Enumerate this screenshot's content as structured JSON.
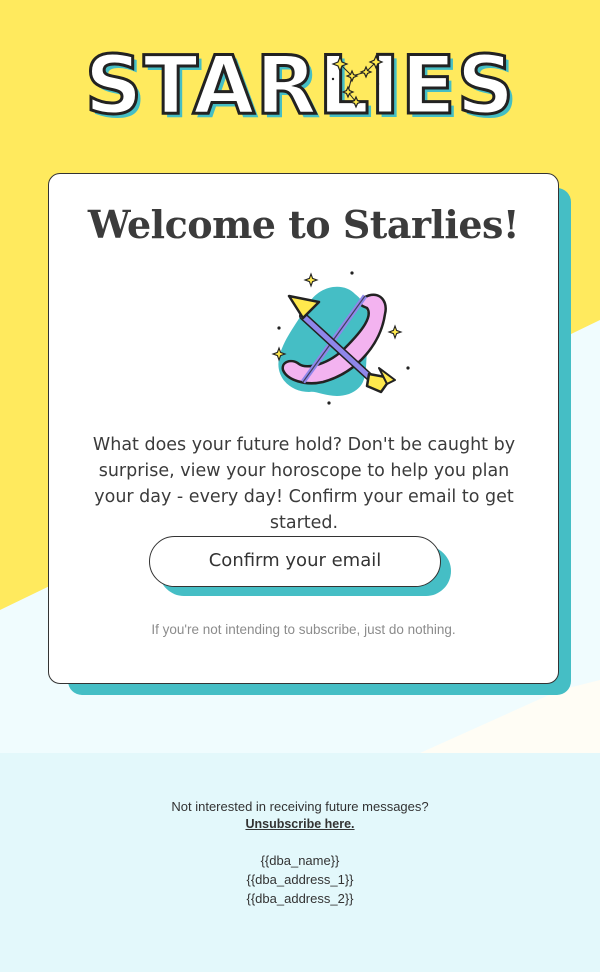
{
  "brand": {
    "logo_text": "STARLIES",
    "colors": {
      "yellow": "#ffea5e",
      "teal": "#45bec5",
      "pink": "#f3b3f0",
      "purple": "#8f86ea",
      "light_blue": "#e3f8fb",
      "text": "#3b3b3b"
    }
  },
  "card": {
    "title": "Welcome to Starlies!",
    "illustration": "sagittarius-bow-and-arrow-icon",
    "body": "What does your future hold? Don't be caught by surprise, view your horoscope to help you plan your day - every day! Confirm your email to get started.",
    "cta_label": "Confirm your email",
    "note": "If you're not intending to subscribe, just do nothing."
  },
  "footer": {
    "question": "Not interested in receiving future messages?",
    "unsubscribe_label": "Unsubscribe here.",
    "address_lines": [
      "{{dba_name}}",
      "{{dba_address_1}}",
      "{{dba_address_2}}"
    ]
  }
}
